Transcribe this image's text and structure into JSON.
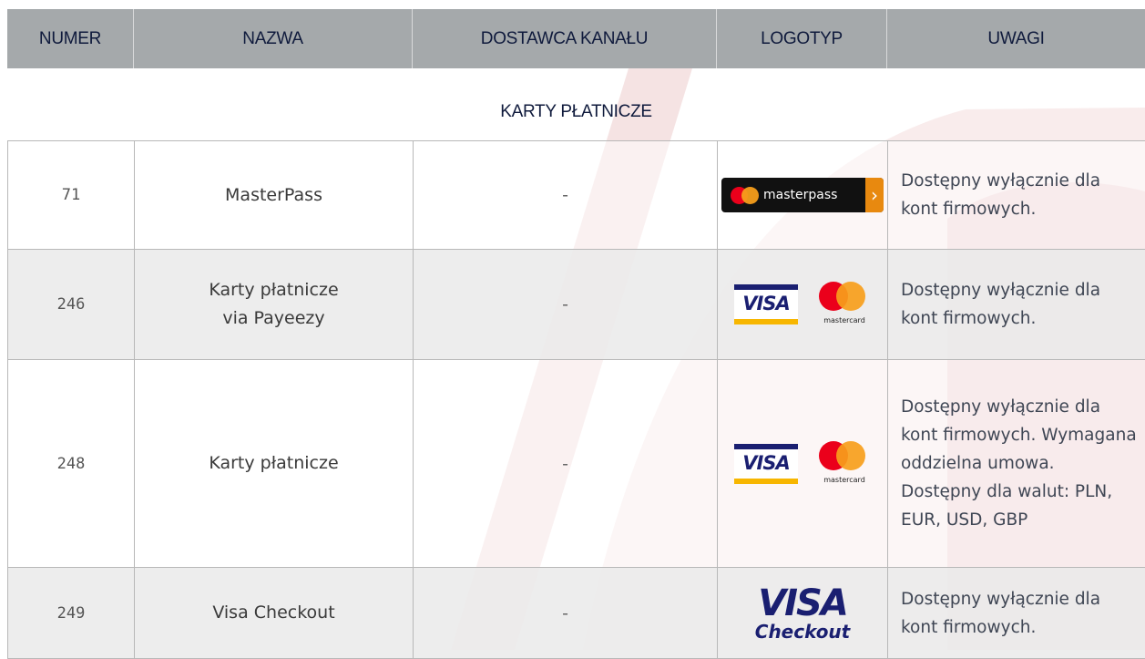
{
  "header": {
    "columns": [
      "NUMER",
      "NAZWA",
      "DOSTAWCA KANAŁU",
      "LOGOTYP",
      "UWAGI"
    ]
  },
  "section": {
    "title": "KARTY PŁATNICZE"
  },
  "rows": [
    {
      "number": "71",
      "name": "MasterPass",
      "provider": "-",
      "logo": "masterpass-logo",
      "logo_text": "masterpass",
      "note": "Dostępny wyłącznie dla kont firmowych."
    },
    {
      "number": "246",
      "name": "Karty płatnicze via Payeezy",
      "provider": "-",
      "logo": "visa-mastercard-logo",
      "visa_text": "VISA",
      "mc_text": "mastercard",
      "note": "Dostępny wyłącznie dla kont firmowych."
    },
    {
      "number": "248",
      "name": "Karty płatnicze",
      "provider": "-",
      "logo": "visa-mastercard-logo",
      "visa_text": "VISA",
      "mc_text": "mastercard",
      "note": "Dostępny wyłącznie dla kont firmowych. Wymagana oddzielna umowa. Dostępny dla walut: PLN, EUR, USD, GBP"
    },
    {
      "number": "249",
      "name": "Visa Checkout",
      "provider": "-",
      "logo": "visa-checkout-logo",
      "visa_text": "VISA",
      "checkout_text": "Checkout",
      "note": "Dostępny wyłącznie dla kont firmowych."
    }
  ],
  "colors": {
    "header_bg": "#a0a4a6",
    "header_text": "#0f1a3c",
    "watermark": "#c8102e"
  }
}
